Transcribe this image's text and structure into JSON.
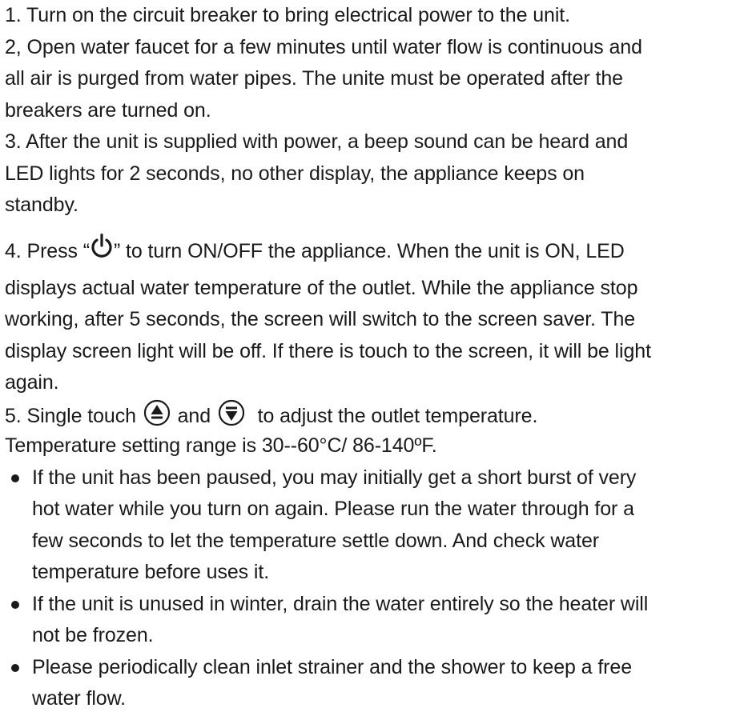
{
  "steps": {
    "s1": "1. Turn on the circuit breaker to bring electrical power to the unit.",
    "s2_l1": "2, Open water faucet for a few minutes until water flow is continuous and",
    "s2_l2": "all air is purged from water pipes. The unite must be operated after the",
    "s2_l3": "breakers are turned on.",
    "s3_l1": "3. After the unit is supplied with power, a beep sound can be heard and",
    "s3_l2": "LED lights for 2 seconds, no other display, the appliance keeps on",
    "s3_l3": "standby.",
    "s4_pre": "4. Press “",
    "s4_post": "” to turn ON/OFF the appliance. When the unit is ON, LED",
    "s4_l2": "displays actual water temperature of the outlet. While the appliance stop",
    "s4_l3": "working, after 5 seconds, the screen will switch to the screen saver. The",
    "s4_l4": "display screen light will be off. If there is touch to the screen, it will be light",
    "s4_l5": "again.",
    "s5_pre": "5. Single touch",
    "s5_mid": "and",
    "s5_post": "to adjust the outlet temperature.",
    "s5_l2": "Temperature setting range is 30--60°C/ 86-140ºF."
  },
  "bullets": [
    {
      "lines": [
        "If the unit has been paused, you may initially get a short burst of very",
        "hot water while you turn on again. Please run the water through for a",
        "few seconds to let the temperature settle down. And check water",
        "temperature before uses it."
      ]
    },
    {
      "lines": [
        "If the unit is unused in winter, drain the water entirely so the heater will",
        "not be frozen."
      ]
    },
    {
      "lines": [
        "Please periodically clean inlet strainer and the shower to keep a free",
        "water flow."
      ]
    }
  ],
  "icons": {
    "power": "power-icon",
    "up": "up-arrow-circle-icon",
    "down": "down-arrow-circle-icon"
  }
}
